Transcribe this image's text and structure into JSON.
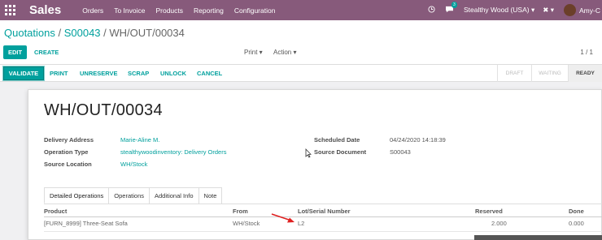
{
  "topbar": {
    "app_name": "Sales",
    "menu": [
      "Orders",
      "To Invoice",
      "Products",
      "Reporting",
      "Configuration"
    ],
    "chat_count": "3",
    "company": "Stealthy Wood (USA)",
    "user": "Amy-C",
    "bg_color": "#875a7b"
  },
  "breadcrumb": {
    "root": "Quotations",
    "sep1": " / ",
    "order": "S00043",
    "sep2": " / ",
    "current": "WH/OUT/00034"
  },
  "controls": {
    "edit": "EDIT",
    "create": "CREATE",
    "print": "Print",
    "action": "Action",
    "pager": "1 / 1"
  },
  "statusbar": {
    "validate": "VALIDATE",
    "actions": [
      "PRINT",
      "UNRESERVE",
      "SCRAP",
      "UNLOCK",
      "CANCEL"
    ],
    "stages": [
      "DRAFT",
      "WAITING",
      "READY"
    ],
    "active_stage": "READY"
  },
  "record": {
    "title": "WH/OUT/00034",
    "fields_left": [
      {
        "label": "Delivery Address",
        "value": "Marie-Aline M."
      },
      {
        "label": "Operation Type",
        "value": "stealthywoodinventory: Delivery Orders"
      },
      {
        "label": "Source Location",
        "value": "WH/Stock"
      }
    ],
    "fields_right": [
      {
        "label": "Scheduled Date",
        "value": "04/24/2020 14:18:39"
      },
      {
        "label": "Source Document",
        "value": "S00043"
      }
    ]
  },
  "tabs": [
    "Detailed Operations",
    "Operations",
    "Additional Info",
    "Note"
  ],
  "table": {
    "headers": [
      "Product",
      "From",
      "Lot/Serial Number",
      "Reserved",
      "Done"
    ],
    "rows": [
      [
        "[FURN_8999] Three-Seat Sofa",
        "WH/Stock",
        "L2",
        "2.000",
        "0.000"
      ]
    ]
  },
  "accent_color": "#00a09d",
  "arrow_color": "#e02020"
}
